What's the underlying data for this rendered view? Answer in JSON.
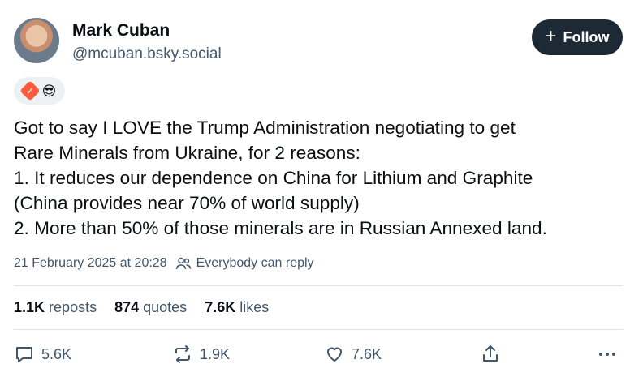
{
  "author": {
    "name": "Mark Cuban",
    "handle": "@mcuban.bsky.social"
  },
  "follow_button": {
    "plus": "+",
    "label": "Follow"
  },
  "badges": {
    "verified_check": "✓",
    "emoji": "😎"
  },
  "post": {
    "lines": [
      "Got to say I LOVE the Trump Administration negotiating to get",
      "Rare Minerals from Ukraine, for 2 reasons:",
      "1. It reduces our dependence on China for Lithium and Graphite",
      "(China provides near 70% of world supply)",
      "2. More than 50% of those minerals are in Russian Annexed land."
    ],
    "timestamp": "21 February 2025 at 20:28",
    "reply_setting": "Everybody can reply"
  },
  "stats": {
    "reposts_count": "1.1K",
    "reposts_label": "reposts",
    "quotes_count": "874",
    "quotes_label": "quotes",
    "likes_count": "7.6K",
    "likes_label": "likes"
  },
  "actions": {
    "reply_count": "5.6K",
    "repost_count": "1.9K",
    "like_count": "7.6K"
  },
  "colors": {
    "text_primary": "#0b0f14",
    "text_secondary": "#42576c",
    "follow_bg": "#1e2936",
    "badge_verified": "#ff5a3c"
  }
}
